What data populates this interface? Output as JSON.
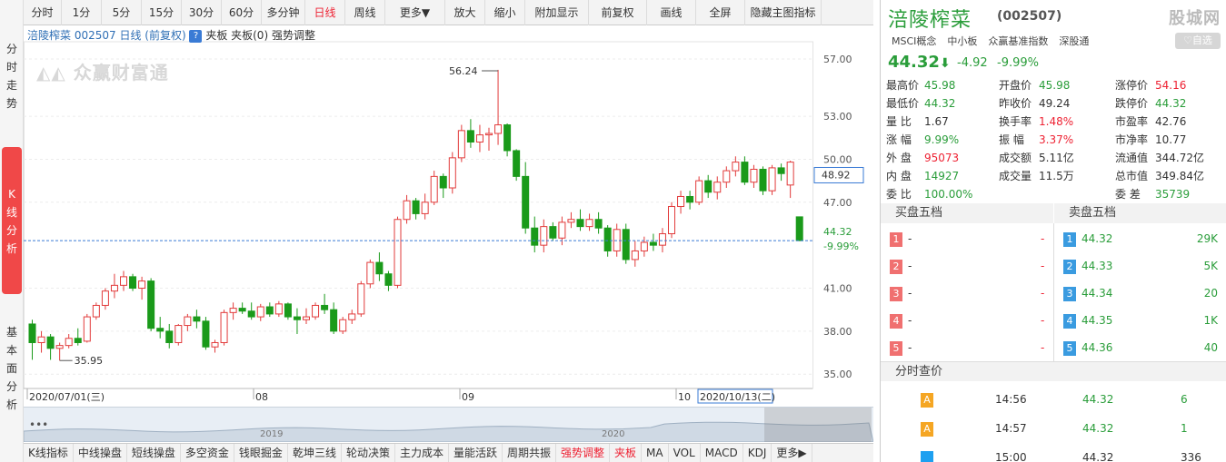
{
  "left_tabs": [
    "分时走势",
    "K线分析",
    "基本面分析"
  ],
  "toolbar": [
    "分时",
    "1分",
    "5分",
    "15分",
    "30分",
    "60分",
    "多分钟",
    "日线",
    "周线",
    "更多▼",
    "放大",
    "缩小",
    "附加显示",
    "前复权",
    "画线",
    "全屏",
    "隐藏主图指标"
  ],
  "toolbar_active": "日线",
  "legend": {
    "name": "涪陵榨菜 002507 日线",
    "adj": "(前复权)",
    "help": "?",
    "rest": "夹板 夹板(0) 强势调整"
  },
  "watermark": "众赢财富通",
  "chart_data": {
    "type": "candlestick",
    "y_ticks": [
      57.0,
      53.0,
      50.0,
      47.0,
      41.0,
      38.0,
      35.0
    ],
    "ylim": [
      34.0,
      58.2
    ],
    "x_labels": [
      "2020/07/01(三)",
      "08",
      "09",
      "10",
      "2020/10/13(二)"
    ],
    "high_label": "56.24",
    "low_label": "35.95",
    "cursor_price": "48.92",
    "last_price": "44.32",
    "last_pct": "-9.99%",
    "candles": [
      [
        38.5,
        38.8,
        36.0,
        37.2
      ],
      [
        37.2,
        38.0,
        36.5,
        37.6
      ],
      [
        37.6,
        37.8,
        36.0,
        36.8
      ],
      [
        36.8,
        37.2,
        35.95,
        37.0
      ],
      [
        37.0,
        37.8,
        36.8,
        37.5
      ],
      [
        37.5,
        38.2,
        37.0,
        37.2
      ],
      [
        37.3,
        39.2,
        37.2,
        39.0
      ],
      [
        39.0,
        40.0,
        38.8,
        39.8
      ],
      [
        39.8,
        41.0,
        39.5,
        40.8
      ],
      [
        40.8,
        42.0,
        40.3,
        41.2
      ],
      [
        41.2,
        42.2,
        40.8,
        41.8
      ],
      [
        41.8,
        42.0,
        40.8,
        41.0
      ],
      [
        41.0,
        41.8,
        40.2,
        41.5
      ],
      [
        41.5,
        41.7,
        38.0,
        38.2
      ],
      [
        38.2,
        39.0,
        37.5,
        38.0
      ],
      [
        38.0,
        38.5,
        36.8,
        37.2
      ],
      [
        37.2,
        38.5,
        37.0,
        38.4
      ],
      [
        38.4,
        39.2,
        38.0,
        39.0
      ],
      [
        39.0,
        39.5,
        38.2,
        38.7
      ],
      [
        38.7,
        39.0,
        36.7,
        36.9
      ],
      [
        36.9,
        37.4,
        36.5,
        37.2
      ],
      [
        37.2,
        39.5,
        37.0,
        39.3
      ],
      [
        39.3,
        40.0,
        38.8,
        39.6
      ],
      [
        39.6,
        40.0,
        39.2,
        39.4
      ],
      [
        39.4,
        40.0,
        38.8,
        39.0
      ],
      [
        39.0,
        39.9,
        38.7,
        39.7
      ],
      [
        39.7,
        40.0,
        39.0,
        39.2
      ],
      [
        39.2,
        40.1,
        39.0,
        39.9
      ],
      [
        39.9,
        40.0,
        38.8,
        39.0
      ],
      [
        39.0,
        39.6,
        37.8,
        38.8
      ],
      [
        38.8,
        39.6,
        38.5,
        39.0
      ],
      [
        39.0,
        40.0,
        38.8,
        39.8
      ],
      [
        39.8,
        40.6,
        39.2,
        39.5
      ],
      [
        39.5,
        40.0,
        37.8,
        38.0
      ],
      [
        38.0,
        39.0,
        37.8,
        38.8
      ],
      [
        38.8,
        39.5,
        38.5,
        39.2
      ],
      [
        39.2,
        41.5,
        39.0,
        41.3
      ],
      [
        41.3,
        43.0,
        41.0,
        42.8
      ],
      [
        42.8,
        43.5,
        41.5,
        42.0
      ],
      [
        42.0,
        42.2,
        40.8,
        41.2
      ],
      [
        41.2,
        46.0,
        41.0,
        45.8
      ],
      [
        45.8,
        47.5,
        45.5,
        47.1
      ],
      [
        47.1,
        47.3,
        45.8,
        46.2
      ],
      [
        46.2,
        47.6,
        45.8,
        47.0
      ],
      [
        47.0,
        49.2,
        46.8,
        48.8
      ],
      [
        48.8,
        49.0,
        47.3,
        48.0
      ],
      [
        48.0,
        50.5,
        47.6,
        50.1
      ],
      [
        50.1,
        52.4,
        49.8,
        52.0
      ],
      [
        52.0,
        52.8,
        50.8,
        51.2
      ],
      [
        51.2,
        52.4,
        50.5,
        51.7
      ],
      [
        51.7,
        52.2,
        50.6,
        51.8
      ],
      [
        51.8,
        56.24,
        51.0,
        52.4
      ],
      [
        52.4,
        52.5,
        50.2,
        50.6
      ],
      [
        50.6,
        50.7,
        48.5,
        48.8
      ],
      [
        48.8,
        49.8,
        44.8,
        45.2
      ],
      [
        45.2,
        46.0,
        43.5,
        44.0
      ],
      [
        44.0,
        45.8,
        43.5,
        45.3
      ],
      [
        45.3,
        45.6,
        44.3,
        44.5
      ],
      [
        44.5,
        46.0,
        44.0,
        45.6
      ],
      [
        45.6,
        46.3,
        45.2,
        45.8
      ],
      [
        45.8,
        46.5,
        45.0,
        45.3
      ],
      [
        45.3,
        46.2,
        45.0,
        45.8
      ],
      [
        45.8,
        46.3,
        44.8,
        45.2
      ],
      [
        45.2,
        45.4,
        43.2,
        43.6
      ],
      [
        43.6,
        45.5,
        43.2,
        45.1
      ],
      [
        45.1,
        45.5,
        42.7,
        43.0
      ],
      [
        43.0,
        44.3,
        42.5,
        43.6
      ],
      [
        43.6,
        44.6,
        43.2,
        44.2
      ],
      [
        44.2,
        44.8,
        43.6,
        44.0
      ],
      [
        44.0,
        45.2,
        43.5,
        44.8
      ],
      [
        44.8,
        47.0,
        44.5,
        46.7
      ],
      [
        46.7,
        47.8,
        46.2,
        47.4
      ],
      [
        47.4,
        47.8,
        46.5,
        47.0
      ],
      [
        47.0,
        48.8,
        46.8,
        48.5
      ],
      [
        48.5,
        48.9,
        47.3,
        47.7
      ],
      [
        47.7,
        48.8,
        47.2,
        48.4
      ],
      [
        48.4,
        49.5,
        48.0,
        49.2
      ],
      [
        49.2,
        50.2,
        48.8,
        49.8
      ],
      [
        49.8,
        50.2,
        48.2,
        48.4
      ],
      [
        48.4,
        49.6,
        48.0,
        49.3
      ],
      [
        49.3,
        49.5,
        47.5,
        47.8
      ],
      [
        47.8,
        49.6,
        47.5,
        49.4
      ],
      [
        49.4,
        49.7,
        48.5,
        49.0
      ],
      [
        48.2,
        49.9,
        47.3,
        49.8
      ],
      [
        45.98,
        45.98,
        44.32,
        44.32
      ]
    ]
  },
  "nav": {
    "label_2019": "2019",
    "label_2020": "2020",
    "dots": "•••"
  },
  "bottom_tabs": [
    "K线指标",
    "中线操盘",
    "短线操盘",
    "多空资金",
    "钱眼掘金",
    "乾坤三线",
    "轮动决策",
    "主力成本",
    "量能活跃",
    "周期共振",
    "强势调整",
    "夹板",
    "MA",
    "VOL",
    "MACD",
    "KDJ",
    "更多▶"
  ],
  "bottom_tabs_red": [
    "强势调整",
    "夹板"
  ],
  "stock": {
    "name": "涪陵榨菜",
    "code": "(002507)",
    "logo": "股城网",
    "fav": "♡自选",
    "tags": [
      "MSCI概念",
      "中小板",
      "众赢基准指数",
      "深股通"
    ],
    "price": "44.32",
    "arrow": "⬇",
    "change": "-4.92",
    "pct": "-9.99%"
  },
  "quote_rows": [
    [
      [
        "最高价",
        "45.98",
        "g"
      ],
      [
        "开盘价",
        "45.98",
        "g"
      ],
      [
        "涨停价",
        "54.16",
        "r"
      ]
    ],
    [
      [
        "最低价",
        "44.32",
        "g"
      ],
      [
        "昨收价",
        "49.24",
        "k"
      ],
      [
        "跌停价",
        "44.32",
        "g"
      ]
    ],
    [
      [
        "量  比",
        "1.67",
        "k"
      ],
      [
        "换手率",
        "1.48%",
        "r"
      ],
      [
        "市盈率",
        "42.76",
        "k"
      ]
    ],
    [
      [
        "涨  幅",
        "9.99%",
        "g"
      ],
      [
        "振  幅",
        "3.37%",
        "r"
      ],
      [
        "市净率",
        "10.77",
        "k"
      ]
    ],
    [
      [
        "外  盘",
        "95073",
        "r"
      ],
      [
        "成交额",
        "5.11亿",
        "k"
      ],
      [
        "流通值",
        "344.72亿",
        "k"
      ]
    ],
    [
      [
        "内  盘",
        "14927",
        "g"
      ],
      [
        "成交量",
        "11.5万",
        "k"
      ],
      [
        "总市值",
        "349.84亿",
        "k"
      ]
    ],
    [
      [
        "委  比",
        "100.00%",
        "g"
      ],
      [
        "",
        "",
        "k"
      ],
      [
        "委  差",
        "35739",
        "g"
      ]
    ]
  ],
  "orderbook": {
    "buy_title": "买盘五档",
    "sell_title": "卖盘五档",
    "buy": [
      [
        "1",
        "-",
        "-"
      ],
      [
        "2",
        "-",
        "-"
      ],
      [
        "3",
        "-",
        "-"
      ],
      [
        "4",
        "-",
        "-"
      ],
      [
        "5",
        "-",
        "-"
      ]
    ],
    "sell": [
      [
        "1",
        "44.32",
        "29K"
      ],
      [
        "2",
        "44.33",
        "5K"
      ],
      [
        "3",
        "44.34",
        "20"
      ],
      [
        "4",
        "44.35",
        "1K"
      ],
      [
        "5",
        "44.36",
        "40"
      ]
    ]
  },
  "timeshare": {
    "title": "分时查价",
    "rows": [
      [
        "A",
        "14:56",
        "44.32",
        "6"
      ],
      [
        "A",
        "14:57",
        "44.32",
        "1"
      ],
      [
        "",
        "15:00",
        "44.32",
        "336"
      ]
    ]
  },
  "colors": {
    "up": "#e23b3b",
    "down": "#1a9a1a",
    "accent": "#f04848"
  }
}
